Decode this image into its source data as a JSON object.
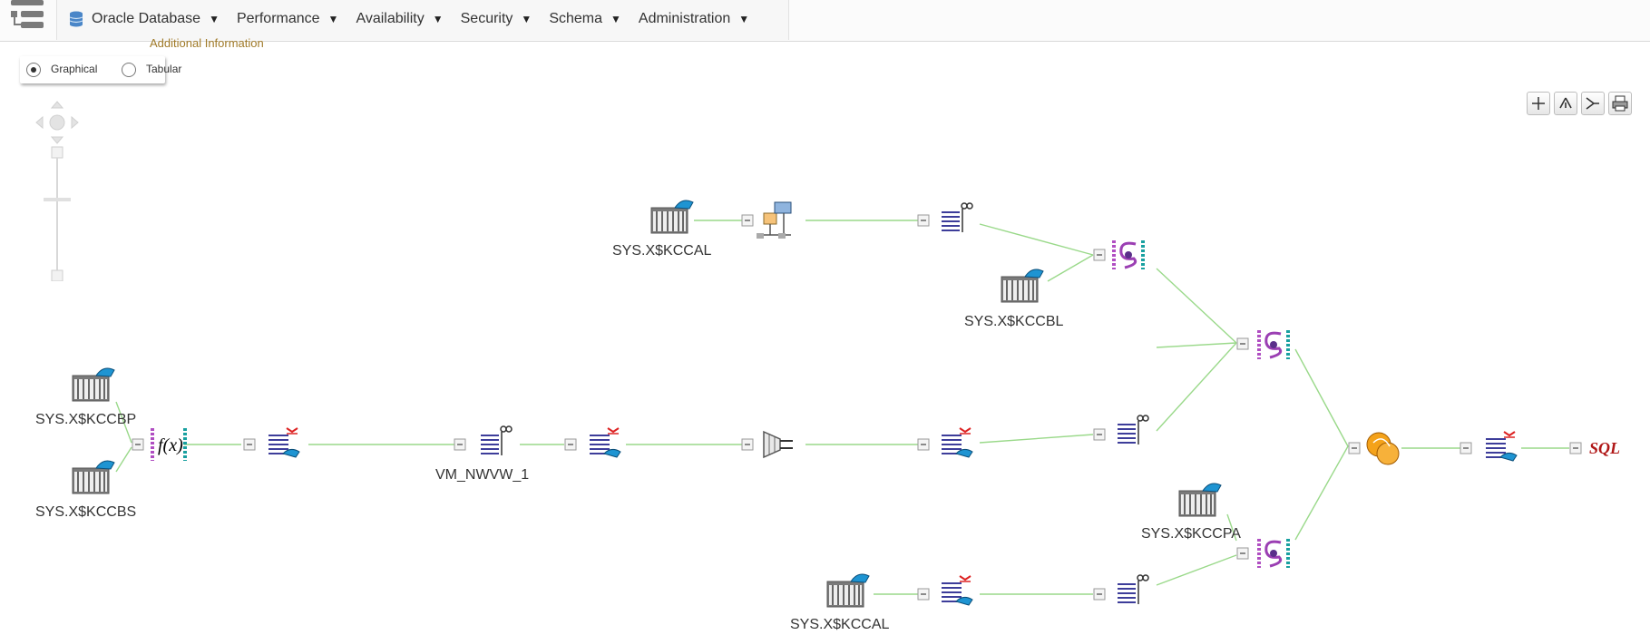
{
  "menubar": {
    "items": [
      {
        "label": "Oracle Database",
        "icon": "database-icon"
      },
      {
        "label": "Performance"
      },
      {
        "label": "Availability"
      },
      {
        "label": "Security"
      },
      {
        "label": "Schema"
      },
      {
        "label": "Administration"
      }
    ]
  },
  "additional_info": "Additional Information",
  "view_toggle": {
    "options": [
      "Graphical",
      "Tabular"
    ],
    "selected": "Graphical"
  },
  "toolbar": {
    "buttons": [
      "zoom-to-fit-icon",
      "tree-layout-icon",
      "horizontal-layout-icon",
      "print-icon"
    ]
  },
  "plan": {
    "labels": {
      "kccal_top": "SYS.X$KCCAL",
      "kccbl": "SYS.X$KCCBL",
      "kccbp": "SYS.X$KCCBP",
      "kccbs": "SYS.X$KCCBS",
      "view": "VM_NWVW_1",
      "kccpa": "SYS.X$KCCPA",
      "kccal_bottom": "SYS.X$KCCAL"
    },
    "sql_label": "SQL"
  },
  "colors": {
    "edge": "#9ad98a",
    "accent": "#a07a28",
    "sql": "#b01717"
  }
}
